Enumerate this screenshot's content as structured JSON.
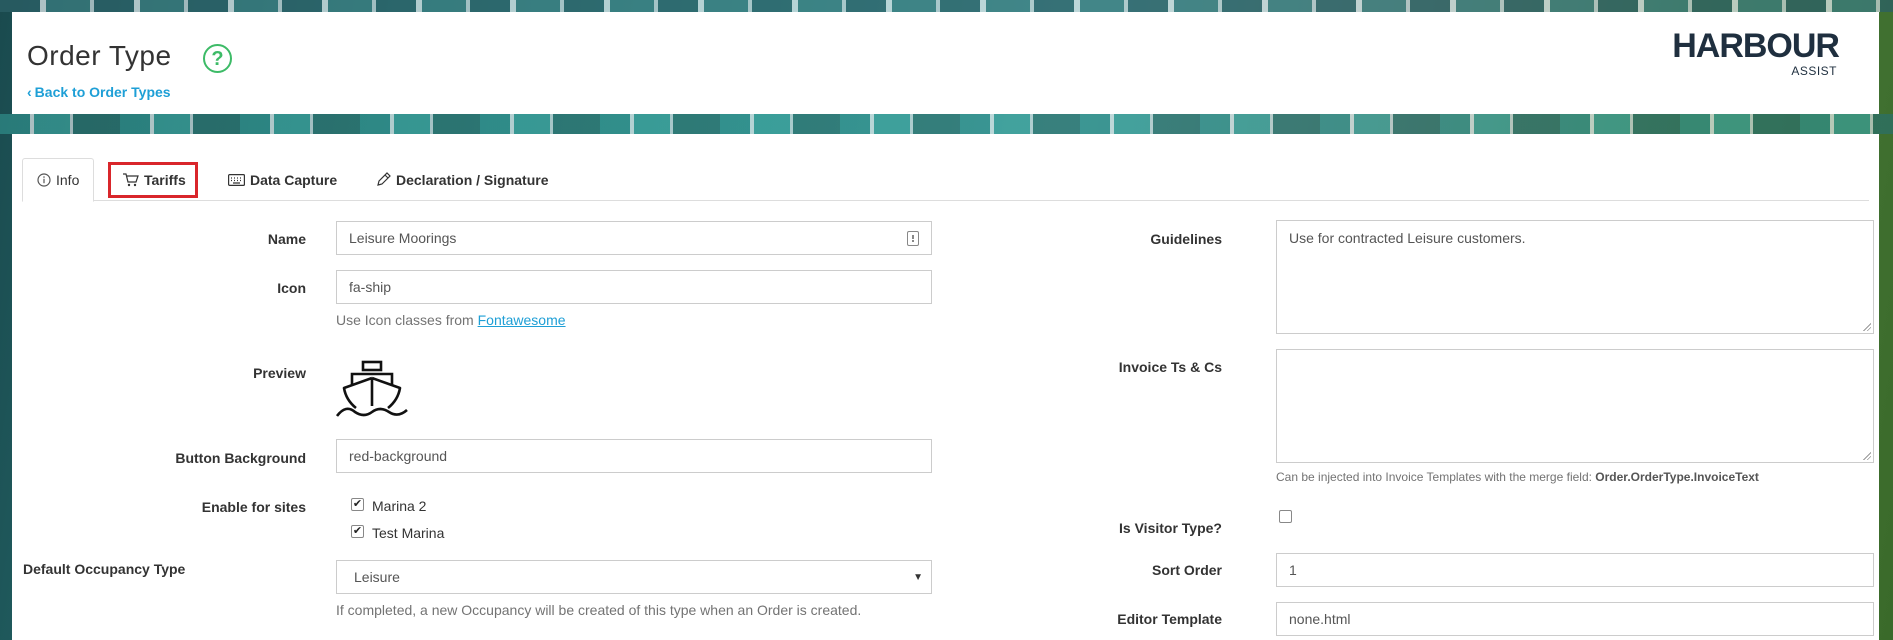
{
  "header": {
    "title": "Order Type",
    "help_icon": "question-circle-icon",
    "back_link": "Back to Order Types",
    "logo_main": "HARBOUR",
    "logo_sub": "ASSIST"
  },
  "tabs": [
    {
      "label": "Info",
      "icon": "info-circle-icon",
      "active": true
    },
    {
      "label": "Tariffs",
      "icon": "shopping-cart-icon",
      "active": false,
      "highlighted": true
    },
    {
      "label": "Data Capture",
      "icon": "keyboard-icon",
      "active": false
    },
    {
      "label": "Declaration / Signature",
      "icon": "pen-icon",
      "active": false
    }
  ],
  "form_left": {
    "name_label": "Name",
    "name_value": "Leisure Moorings",
    "icon_label": "Icon",
    "icon_value": "fa-ship",
    "icon_help_prefix": "Use Icon classes from ",
    "icon_help_link": "Fontawesome",
    "preview_label": "Preview",
    "preview_icon": "ship-icon",
    "button_bg_label": "Button Background",
    "button_bg_value": "red-background",
    "enable_sites_label": "Enable for sites",
    "sites": [
      {
        "label": "Marina 2",
        "checked": true
      },
      {
        "label": "Test Marina",
        "checked": true
      }
    ],
    "occupancy_label": "Default Occupancy Type",
    "occupancy_value": "Leisure",
    "occupancy_help": "If completed, a new Occupancy will be created of this type when an Order is created."
  },
  "form_right": {
    "guidelines_label": "Guidelines",
    "guidelines_value": "Use for contracted Leisure customers.",
    "invoice_label": "Invoice Ts & Cs",
    "invoice_value": "",
    "invoice_help_prefix": "Can be injected into Invoice Templates with the merge field: ",
    "invoice_help_field": "Order.OrderType.InvoiceText",
    "visitor_label": "Is Visitor Type?",
    "visitor_checked": false,
    "sort_label": "Sort Order",
    "sort_value": "1",
    "editor_label": "Editor Template",
    "editor_value": "none.html"
  },
  "colors": {
    "accent": "#1e9fd6",
    "help_green": "#3dbb67",
    "highlight_red": "#d9262b"
  }
}
